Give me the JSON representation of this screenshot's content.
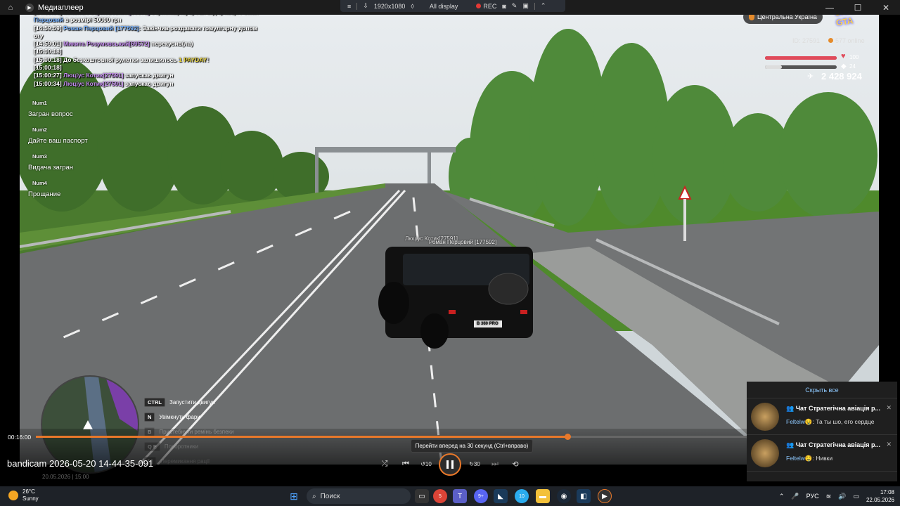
{
  "window": {
    "title": "Медиаплеер"
  },
  "rec_toolbar": {
    "resolution": "1920x1080",
    "display": "All display",
    "rec": "REC"
  },
  "chat": [
    {
      "parts": [
        {
          "c": "t",
          "s": "[14:59:58] "
        },
        {
          "c": "p",
          "s": "Микита Розумовський[69572]"
        },
        {
          "c": "t",
          "s": " отримав(ла) гроші від гравця Роман"
        }
      ]
    },
    {
      "parts": [
        {
          "c": "b",
          "s": "Перцовий"
        },
        {
          "c": "t",
          "s": " в розмірі 50000 грн"
        }
      ]
    },
    {
      "parts": [
        {
          "c": "t",
          "s": "[14:59:59] "
        },
        {
          "c": "b",
          "s": "Роман Перцовий [177592]"
        },
        {
          "c": "t",
          "s": ": Закінчив роздавати гомулгарну допом"
        }
      ]
    },
    {
      "parts": [
        {
          "c": "t",
          "s": "огу"
        }
      ]
    },
    {
      "parts": [
        {
          "c": "t",
          "s": "[14:59:01] "
        },
        {
          "c": "p",
          "s": "Микита Розумовський[69572]"
        },
        {
          "c": "t",
          "s": " перекусив(ла)"
        }
      ]
    },
    {
      "parts": [
        {
          "c": "t",
          "s": "[15:00:18]"
        }
      ]
    },
    {
      "parts": [
        {
          "c": "t",
          "s": "[15:00:18] До безкоштовної рулетки залишилось "
        },
        {
          "c": "y",
          "s": "1 PAYDAY"
        },
        {
          "c": "t",
          "s": "!"
        }
      ]
    },
    {
      "parts": [
        {
          "c": "t",
          "s": "[15:00:18]"
        }
      ]
    },
    {
      "parts": [
        {
          "c": "t",
          "s": "[15:00:27] "
        },
        {
          "c": "p",
          "s": "Люціус Котик[27591]"
        },
        {
          "c": "t",
          "s": " запускає двигун"
        }
      ]
    },
    {
      "parts": [
        {
          "c": "t",
          "s": "[15:00:34] "
        },
        {
          "c": "p",
          "s": "Люціус Котик[27591]"
        },
        {
          "c": "t",
          "s": " запускає двигун"
        }
      ]
    }
  ],
  "num_menu": [
    {
      "key": "Num1",
      "label": "Загран вопрос"
    },
    {
      "key": "Num2",
      "label": "Дайте ваш паспорт"
    },
    {
      "key": "Num3",
      "label": "Видача загран"
    },
    {
      "key": "Num4",
      "label": "Прощание"
    }
  ],
  "hud": {
    "region": "Центральна Україна",
    "logo_text": "UKRAINE GTA",
    "player_id": "ID: 27591",
    "online": "577 online",
    "health": "100",
    "armor": "24",
    "health_fraction": 1.0,
    "armor_fraction": 0.24,
    "money": "2 428 924",
    "nametag_1": "Люціус Котик[27591]",
    "nametag_2": "Роман Перцовий [177592]",
    "plate": "B 360 PRO"
  },
  "hints": [
    {
      "key": "CTRL",
      "label": "Запустити двигун",
      "dim": false
    },
    {
      "key": "N",
      "label": "Увімкнути фари",
      "dim": false
    },
    {
      "key": "B",
      "label": "Пристебнути ремінь безпеки",
      "dim": true
    },
    {
      "key": "Q E",
      "label": "Поворотники",
      "dim": true
    },
    {
      "key": "[ ]",
      "label": "Перемикання рації",
      "dim": true
    }
  ],
  "player": {
    "time": "00:16:00",
    "progress": 0.748,
    "tooltip": "Перейти вперед на 30 секунд (Ctrl+вправо)",
    "filename": "bandicam 2026-05-20 14-44-35-091",
    "overlay_ts": "20.05.2026 | 15:00",
    "back_label": "10",
    "fwd_label": "30"
  },
  "notifications": {
    "hide_all": "Скрыть все",
    "items": [
      {
        "title": "Чат Стратегічна авіація р...",
        "sender": "Feltelw🤤",
        "text": ": Та ты шо, его сердце"
      },
      {
        "title": "Чат Стратегічна авіація р...",
        "sender": "Feltelw🤤",
        "text": ": Нивки"
      }
    ]
  },
  "taskbar": {
    "temp": "26°C",
    "condition": "Sunny",
    "search_placeholder": "Поиск",
    "lang": "РУС",
    "time": "17:08",
    "date": "22.05.2026",
    "chrome_badge": "5",
    "discord_badge": "9+",
    "telegram_badge": "10"
  }
}
